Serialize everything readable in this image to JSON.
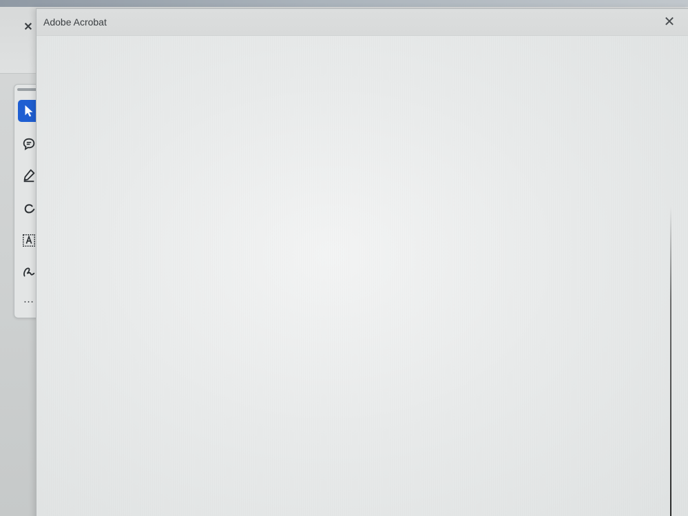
{
  "background_window": {
    "close_glyph": "✕"
  },
  "tool_palette": {
    "tools": [
      {
        "name": "select-tool",
        "icon": "arrow-cursor-icon",
        "active": true
      },
      {
        "name": "comment-tool",
        "icon": "comment-icon",
        "active": false
      },
      {
        "name": "highlight-tool",
        "icon": "pen-icon",
        "active": false
      },
      {
        "name": "draw-tool",
        "icon": "loop-icon",
        "active": false
      },
      {
        "name": "text-box-tool",
        "icon": "text-box-icon",
        "active": false
      },
      {
        "name": "signature-tool",
        "icon": "signature-icon",
        "active": false
      }
    ],
    "more_label": "…"
  },
  "dialog": {
    "title": "Adobe Acrobat",
    "close_glyph": "✕"
  },
  "colors": {
    "accent": "#1f5fd2",
    "dialog_background": "#e6e8e8",
    "title_text": "#3a3e41"
  }
}
